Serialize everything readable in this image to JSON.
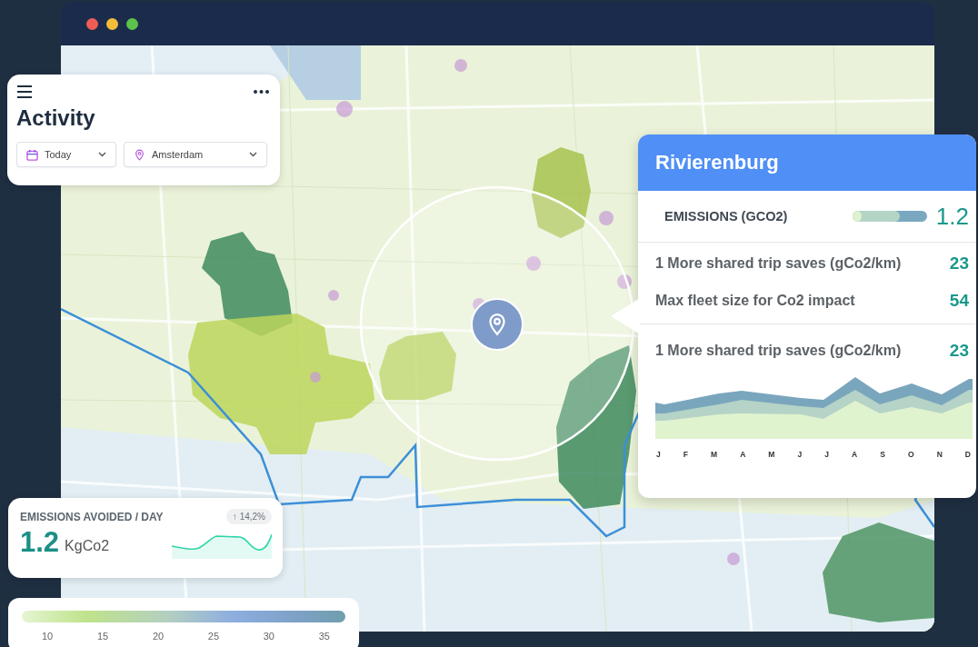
{
  "window": {
    "traffic_lights": [
      {
        "color": "#ee5d55"
      },
      {
        "color": "#f4bc3a"
      },
      {
        "color": "#5cc24b"
      }
    ]
  },
  "activity_card": {
    "title": "Activity",
    "filters": [
      {
        "kind": "date",
        "label": "Today"
      },
      {
        "kind": "location",
        "label": "Amsterdam"
      }
    ]
  },
  "region_panel": {
    "title": "Rivierenburg",
    "emissions": {
      "label": "EMISSIONS (GCO2)",
      "value": "1.2"
    },
    "stats": [
      {
        "label": "1 More shared trip saves (gCo2/km)",
        "value": "23"
      },
      {
        "label": "Max fleet size for Co2 impact",
        "value": "54"
      }
    ],
    "trend": {
      "label": "1 More shared trip saves (gCo2/km)",
      "value": "23",
      "months": [
        "J",
        "F",
        "M",
        "A",
        "M",
        "J",
        "J",
        "A",
        "S",
        "O",
        "N",
        "D"
      ]
    }
  },
  "emissions_card": {
    "label": "EMISSIONS AVOIDED / DAY",
    "change": "↑ 14,2%",
    "value": "1.2",
    "unit": "KgCo2"
  },
  "legend": {
    "ticks": [
      "10",
      "15",
      "20",
      "25",
      "30",
      "35"
    ]
  }
}
